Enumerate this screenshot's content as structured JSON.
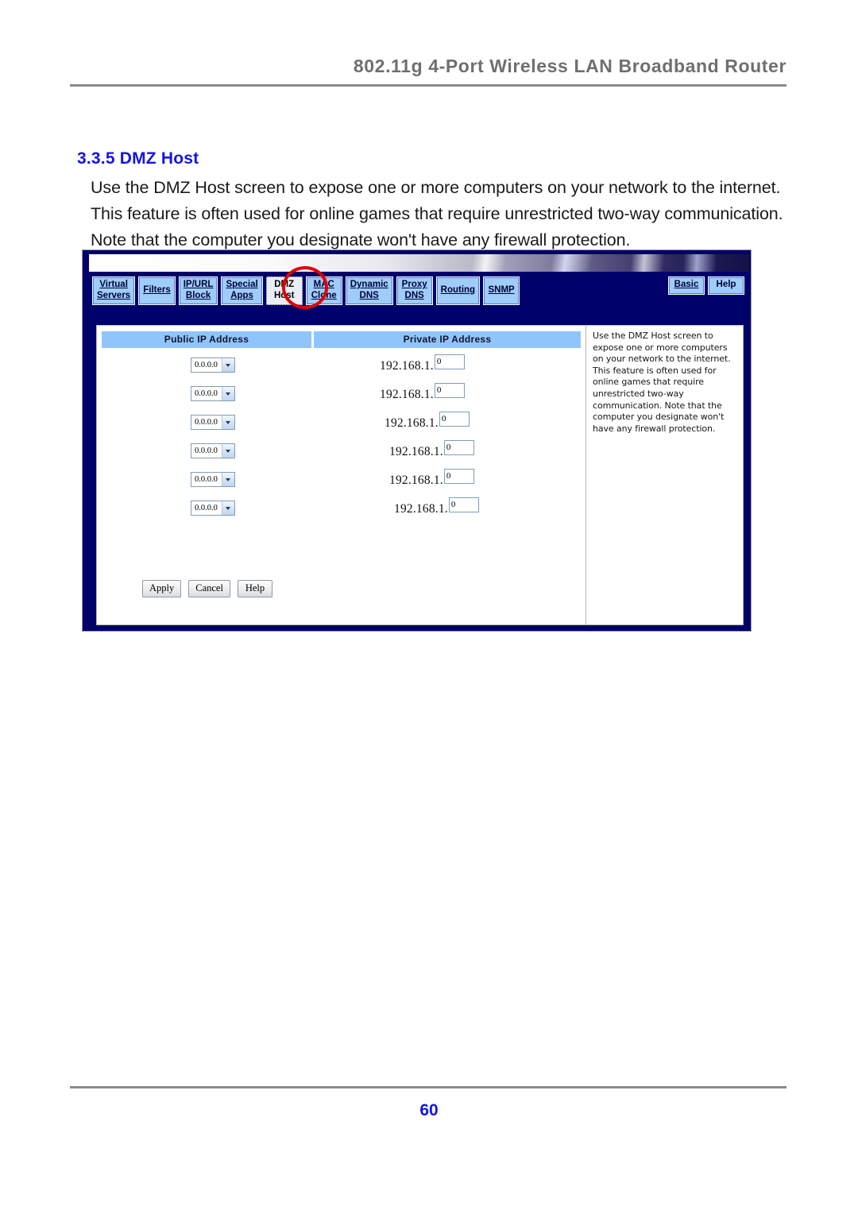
{
  "document": {
    "header_title": "802.11g 4-Port Wireless LAN Broadband Router",
    "section_number_title": "3.3.5 DMZ Host",
    "paragraph": "Use the DMZ Host screen to expose one or more computers on your network to the internet. This feature is often used for online games that require unrestricted two-way communication. Note that the computer you designate won't have any firewall protection.",
    "page_number": "60"
  },
  "annotation": {
    "type": "red-ellipse-highlight",
    "target": "DMZ Host",
    "color": "#e00000"
  },
  "router_ui": {
    "nav_left": [
      {
        "label_line1": "Virtual",
        "label_line2": "Servers",
        "active": false
      },
      {
        "label_line1": "Filters",
        "label_line2": "",
        "active": false
      },
      {
        "label_line1": "IP/URL",
        "label_line2": "Block",
        "active": false
      },
      {
        "label_line1": "Special",
        "label_line2": "Apps",
        "active": false
      },
      {
        "label_line1": "DMZ",
        "label_line2": "Host",
        "active": true
      },
      {
        "label_line1": "MAC",
        "label_line2": "Clone",
        "active": false
      },
      {
        "label_line1": "Dynamic",
        "label_line2": "DNS",
        "active": false
      },
      {
        "label_line1": "Proxy",
        "label_line2": "DNS",
        "active": false
      },
      {
        "label_line1": "Routing",
        "label_line2": "",
        "active": false
      },
      {
        "label_line1": "SNMP",
        "label_line2": "",
        "active": false
      }
    ],
    "nav_right": [
      {
        "label_line1": "Basic",
        "label_line2": "",
        "active": false
      },
      {
        "label_line1": "Help",
        "label_line2": "",
        "active": false,
        "no_underline": true
      }
    ],
    "table": {
      "columns": [
        "Public IP Address",
        "Private IP Address"
      ],
      "rows": [
        {
          "public_ip": "0.0.0.0",
          "private_prefix": "192.168.1.",
          "private_octet": "0"
        },
        {
          "public_ip": "0.0.0.0",
          "private_prefix": "192.168.1.",
          "private_octet": "0"
        },
        {
          "public_ip": "0.0.0.0",
          "private_prefix": "192.168.1.",
          "private_octet": "0"
        },
        {
          "public_ip": "0.0.0.0",
          "private_prefix": "192.168.1.",
          "private_octet": "0"
        },
        {
          "public_ip": "0.0.0.0",
          "private_prefix": "192.168.1.",
          "private_octet": "0"
        },
        {
          "public_ip": "0.0.0.0",
          "private_prefix": "192.168.1.",
          "private_octet": "0"
        }
      ]
    },
    "buttons": [
      {
        "label": "Apply"
      },
      {
        "label": "Cancel"
      },
      {
        "label": "Help"
      }
    ],
    "help_panel_text": "Use the DMZ Host screen to expose one or more computers on your network to the internet. This feature is often used for online games that require unrestricted two-way communication. Note that the computer you designate won't have any firewall protection.",
    "colors": {
      "nav_background": "#00006b",
      "nav_button": "#9ecdfb",
      "table_header": "#8fc5fb",
      "heading_blue": "#1414e6"
    }
  }
}
